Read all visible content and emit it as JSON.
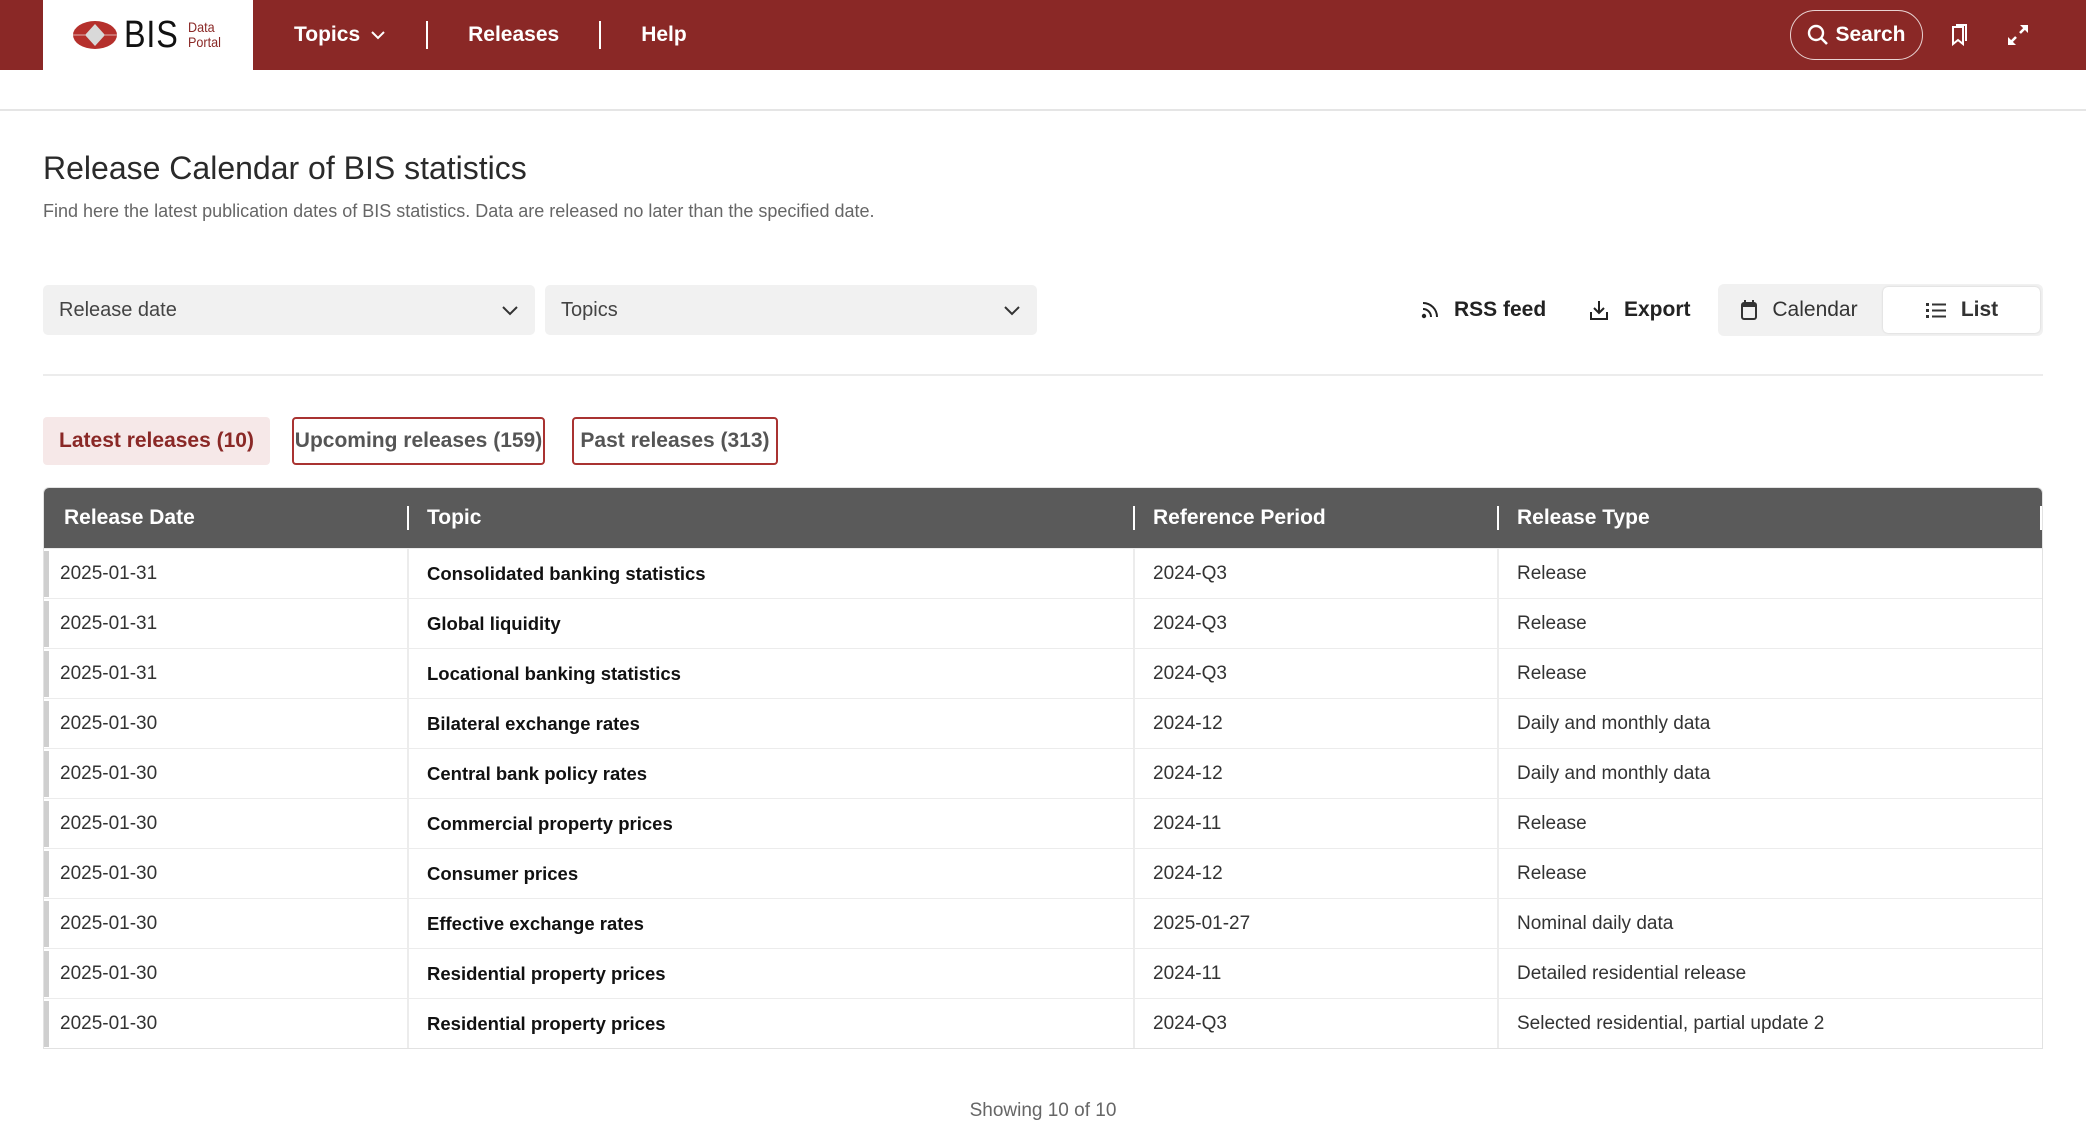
{
  "header": {
    "logo_text": "BIS",
    "logo_sub_line1": "Data",
    "logo_sub_line2": "Portal",
    "nav": [
      {
        "label": "Topics",
        "has_dropdown": true
      },
      {
        "label": "Releases"
      },
      {
        "label": "Help"
      }
    ],
    "search_label": "Search",
    "icons": [
      "bookmark-icon",
      "expand-icon"
    ],
    "brand_color": "#8a2826"
  },
  "page": {
    "title": "Release Calendar of BIS statistics",
    "subtitle": "Find here the latest publication dates of BIS statistics. Data are released no later than the specified date."
  },
  "filters": {
    "release_date": {
      "value": "Release date"
    },
    "topics": {
      "value": "Topics"
    },
    "rss_label": "RSS feed",
    "export_label": "Export",
    "view_toggle": {
      "calendar_label": "Calendar",
      "list_label": "List",
      "selected": "List"
    }
  },
  "tabs": [
    {
      "label": "Latest releases (10)",
      "active": true
    },
    {
      "label": "Upcoming releases (159)",
      "active": false
    },
    {
      "label": "Past releases (313)",
      "active": false
    }
  ],
  "table": {
    "columns": [
      "Release Date",
      "Topic",
      "Reference Period",
      "Release Type"
    ],
    "rows": [
      {
        "date": "2025-01-31",
        "topic": "Consolidated banking statistics",
        "period": "2024-Q3",
        "type": "Release"
      },
      {
        "date": "2025-01-31",
        "topic": "Global liquidity",
        "period": "2024-Q3",
        "type": "Release"
      },
      {
        "date": "2025-01-31",
        "topic": "Locational banking statistics",
        "period": "2024-Q3",
        "type": "Release"
      },
      {
        "date": "2025-01-30",
        "topic": "Bilateral exchange rates",
        "period": "2024-12",
        "type": "Daily and monthly data"
      },
      {
        "date": "2025-01-30",
        "topic": "Central bank policy rates",
        "period": "2024-12",
        "type": "Daily and monthly data"
      },
      {
        "date": "2025-01-30",
        "topic": "Commercial property prices",
        "period": "2024-11",
        "type": "Release"
      },
      {
        "date": "2025-01-30",
        "topic": "Consumer prices",
        "period": "2024-12",
        "type": "Release"
      },
      {
        "date": "2025-01-30",
        "topic": "Effective exchange rates",
        "period": "2025-01-27",
        "type": "Nominal daily data"
      },
      {
        "date": "2025-01-30",
        "topic": "Residential property prices",
        "period": "2024-11",
        "type": "Detailed residential release"
      },
      {
        "date": "2025-01-30",
        "topic": "Residential property prices",
        "period": "2024-Q3",
        "type": "Selected residential, partial update 2"
      }
    ]
  },
  "footer": {
    "showing": "Showing 10 of 10"
  }
}
